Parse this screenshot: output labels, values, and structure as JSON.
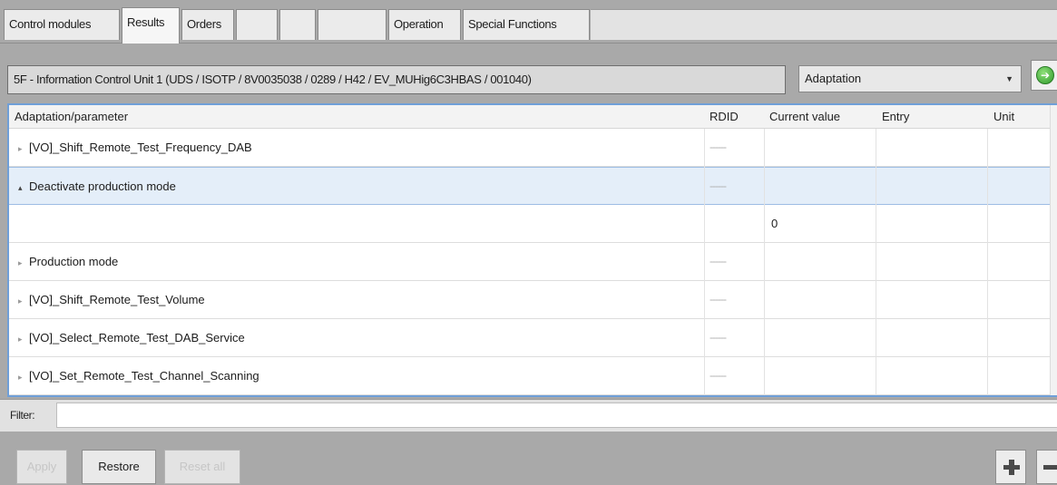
{
  "tabs": [
    {
      "label": "Control modules",
      "state": "normal"
    },
    {
      "label": "Results",
      "state": "active"
    },
    {
      "label": "Orders",
      "state": "normal"
    },
    {
      "label": "",
      "state": "disabled"
    },
    {
      "label": "",
      "state": "disabled"
    },
    {
      "label": "",
      "state": "disabled"
    },
    {
      "label": "Operation",
      "state": "normal"
    },
    {
      "label": "Special Functions",
      "state": "normal"
    }
  ],
  "ecu": {
    "title": "5F - Information Control Unit 1  (UDS / ISOTP / 8V0035038   / 0289 / H42 / EV_MUHig6C3HBAS / 001040)"
  },
  "mode_select": {
    "value": "Adaptation",
    "arrow_icon": "chevron-down-icon"
  },
  "go_button": {
    "icon": "green-arrow-circle-icon",
    "glyph": "➔"
  },
  "table": {
    "columns": {
      "parameter": "Adaptation/parameter",
      "rdid": "RDID",
      "current": "Current value",
      "entry": "Entry",
      "unit": "Unit"
    },
    "rows": [
      {
        "name": "[VO]_Shift_Remote_Test_Frequency_DAB",
        "rdid": "------",
        "current": "",
        "entry": "",
        "unit": "",
        "expander": "▸",
        "selected": false
      },
      {
        "name": "Deactivate production mode",
        "rdid": "------",
        "current": "",
        "entry": "",
        "unit": "",
        "expander": "▴",
        "selected": true
      },
      {
        "name": "",
        "rdid": "",
        "current": "0",
        "entry": "",
        "unit": "",
        "expander": "",
        "selected": false
      },
      {
        "name": "Production mode",
        "rdid": "------",
        "current": "",
        "entry": "",
        "unit": "",
        "expander": "▸",
        "selected": false
      },
      {
        "name": "[VO]_Shift_Remote_Test_Volume",
        "rdid": "------",
        "current": "",
        "entry": "",
        "unit": "",
        "expander": "▸",
        "selected": false
      },
      {
        "name": "[VO]_Select_Remote_Test_DAB_Service",
        "rdid": "------",
        "current": "",
        "entry": "",
        "unit": "",
        "expander": "▸",
        "selected": false
      },
      {
        "name": "[VO]_Set_Remote_Test_Channel_Scanning",
        "rdid": "------",
        "current": "",
        "entry": "",
        "unit": "",
        "expander": "▸",
        "selected": false
      }
    ]
  },
  "filter": {
    "label": "Filter:",
    "value": ""
  },
  "buttons": {
    "apply": "Apply",
    "restore": "Restore",
    "reset_all": "Reset all",
    "add_icon": "plus-icon",
    "remove_icon": "minus-icon"
  },
  "colors": {
    "selection": "#e4eef9",
    "table_border": "#6f9fd8",
    "go_green": "#2e9a2a"
  }
}
